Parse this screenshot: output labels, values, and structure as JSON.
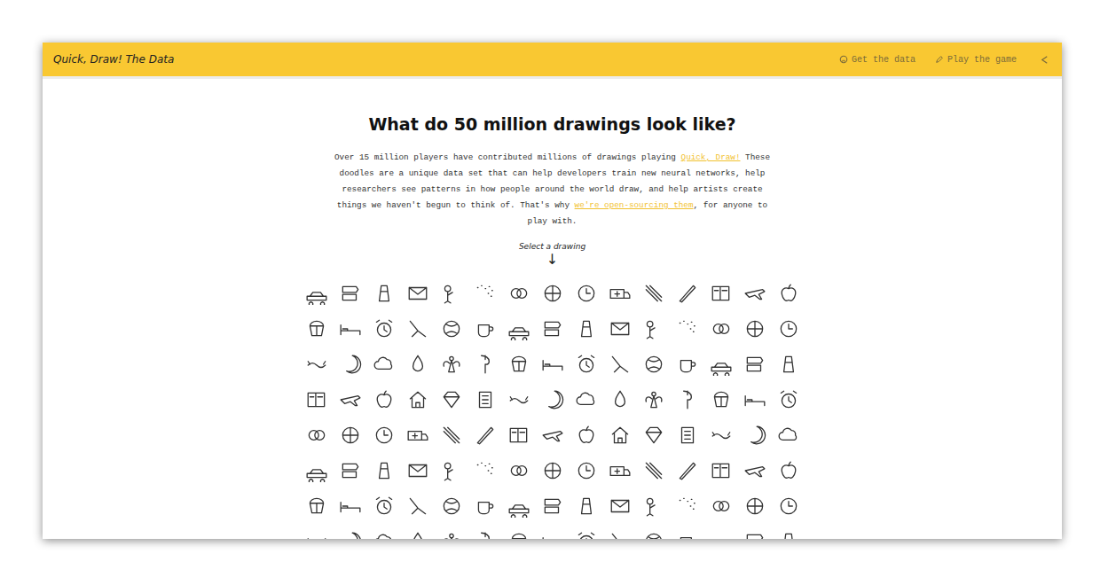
{
  "header": {
    "title": "Quick, Draw! The Data",
    "links": [
      {
        "label": "Get the data"
      },
      {
        "label": "Play the game"
      }
    ]
  },
  "heading": "What do 50 million drawings look like?",
  "intro": [
    {
      "kind": "text",
      "text": "Over 15 million players have contributed millions of drawings playing "
    },
    {
      "kind": "link",
      "text": "Quick, Draw!"
    },
    {
      "kind": "text",
      "text": " These doodles are a unique data set that can help developers train new neural networks, help researchers see patterns in how people around the world draw, and help artists create things we haven't begun to think of. That's why "
    },
    {
      "kind": "link",
      "text": "we're open-sourcing them"
    },
    {
      "kind": "text",
      "text": ", for anyone to play with."
    }
  ],
  "prompt": "Select a drawing",
  "arrow": "↓"
}
